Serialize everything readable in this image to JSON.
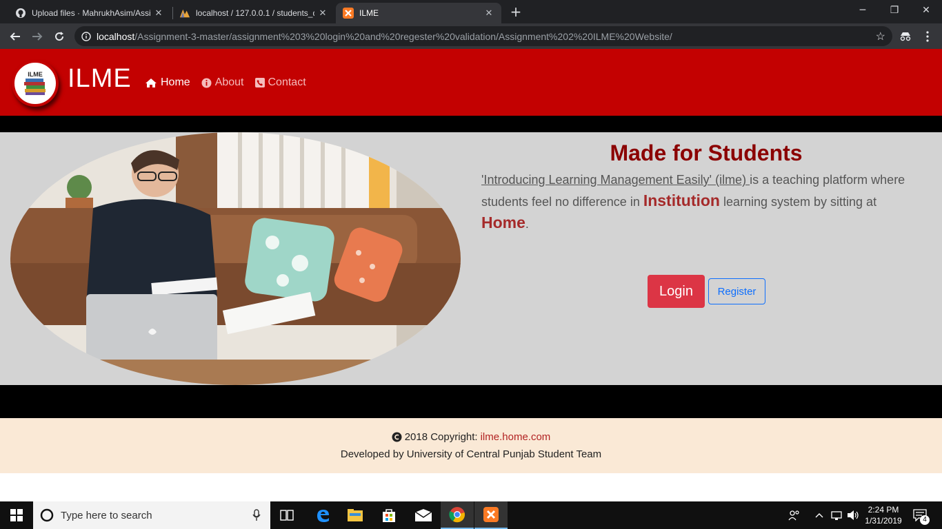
{
  "browser": {
    "tabs": [
      {
        "title": "Upload files · MahrukhAsim/Assig",
        "icon": "github-icon",
        "active": false
      },
      {
        "title": "localhost / 127.0.0.1 / students_d",
        "icon": "phpmyadmin-icon",
        "active": false
      },
      {
        "title": "ILME",
        "icon": "xampp-icon",
        "active": true
      }
    ],
    "new_tab": "+",
    "url_host": "localhost",
    "url_path": "/Assignment-3-master/assignment%203%20login%20and%20regester%20validation/Assignment%202%20ILME%20Website/"
  },
  "site": {
    "logo_text": "ILME",
    "brand": "ILME",
    "nav": [
      {
        "label": "Home",
        "icon": "home-icon",
        "active": true
      },
      {
        "label": "About",
        "icon": "info-icon",
        "active": false
      },
      {
        "label": "Contact",
        "icon": "phone-icon",
        "active": false
      }
    ],
    "hero": {
      "title": "Made for Students",
      "text_link": "'Introducing Learning Management Easily' (ilme) ",
      "text_part1": "is a teaching platform where students feel no difference in ",
      "emphasis1": "Institution",
      "text_part2": " learning system by sitting at ",
      "emphasis2": "Home",
      "text_end": ".",
      "login_label": "Login",
      "register_label": "Register"
    },
    "footer": {
      "copyright_prefix": "2018 Copyright:",
      "copyright_link": "ilme.home.com",
      "credit": "Developed by University of Central Punjab Student Team"
    }
  },
  "taskbar": {
    "search_placeholder": "Type here to search",
    "time": "2:24 PM",
    "date": "1/31/2019",
    "notification_count": "4"
  },
  "colors": {
    "header_red": "#c30101",
    "title_dark_red": "#8b0000",
    "login_red": "#dc3545",
    "register_blue": "#0d6efd",
    "footer_bg": "#fae9d6"
  }
}
